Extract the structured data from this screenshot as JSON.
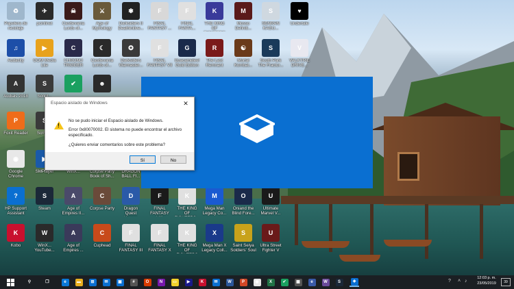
{
  "desktop": {
    "icons": [
      {
        "label": "Papelera de reciclaje",
        "color": "#9fb7cc",
        "glyph": "♻"
      },
      {
        "label": "pcinfinet",
        "color": "#2a2a2a",
        "glyph": "✈"
      },
      {
        "label": "Castlevania Lords of...",
        "color": "#3a1a1a",
        "glyph": "☠"
      },
      {
        "label": "Age of Mythology",
        "color": "#6a5a3a",
        "glyph": "⚔"
      },
      {
        "label": "Darksiders II Deathinitive...",
        "color": "#222",
        "glyph": "✾"
      },
      {
        "label": "FINAL FANTASY ...",
        "color": "#d8d8d8",
        "glyph": "F"
      },
      {
        "label": "FINAL FANTA...",
        "color": "#e0e0e0",
        "glyph": "F"
      },
      {
        "label": "THE KING OF FIGHTERS X...",
        "color": "#3a3a9a",
        "glyph": "K"
      },
      {
        "label": "Mosso Definiti...",
        "color": "#5a1a1a",
        "glyph": "M"
      },
      {
        "label": "SENRAN KAGU...",
        "color": "#cfd8e0",
        "glyph": "S"
      },
      {
        "label": "Undertale",
        "color": "#000",
        "glyph": "♥"
      },
      {
        "label": "Audacity",
        "color": "#1d4fa8",
        "glyph": "♫"
      },
      {
        "label": "GOM Media Lite",
        "color": "#e8a21c",
        "glyph": "▶"
      },
      {
        "label": "CHRONO TRIGGER",
        "color": "#2a2a4a",
        "glyph": "C"
      },
      {
        "label": "Castlevania Lords of...",
        "color": "#2a2a2a",
        "glyph": "☾"
      },
      {
        "label": "Darksiders Warmaster...",
        "color": "#3a3a3a",
        "glyph": "✪"
      },
      {
        "label": "FINAL FANTASY VII",
        "color": "#e0e0e0",
        "glyph": "F"
      },
      {
        "label": "Guacamelee! Gold Edition",
        "color": "#1a2a4a",
        "glyph": "G"
      },
      {
        "label": "The Last Remnant",
        "color": "#7a1a1a",
        "glyph": "R"
      },
      {
        "label": "Mortal Kombat...",
        "color": "#6a3a1a",
        "glyph": "☯"
      },
      {
        "label": "South Park The Fractur...",
        "color": "#1a3a5a",
        "glyph": "S"
      },
      {
        "label": "VALKYRIE DRIVE...",
        "color": "#e8e8f0",
        "glyph": "V"
      },
      {
        "label": "Audials 2018",
        "color": "#333",
        "glyph": "A"
      },
      {
        "label": "Script...",
        "color": "#3a3a3a",
        "glyph": "S"
      },
      {
        "label": "",
        "color": "#1aa060",
        "glyph": "✔"
      },
      {
        "label": "",
        "color": "#2a2a2a",
        "glyph": "☻"
      },
      {
        "label": "Foxit Reader",
        "color": "#ef6c1a",
        "glyph": "P"
      },
      {
        "label": "Scrive...",
        "color": "#3a3a3a",
        "glyph": "S"
      },
      {
        "label": "Google Chrome",
        "color": "#e8e8e8",
        "glyph": "◉"
      },
      {
        "label": "SMPlayer",
        "color": "#1a5aa8",
        "glyph": "▶"
      },
      {
        "label": "WinX...",
        "color": "#555",
        "glyph": "W"
      },
      {
        "label": "Corpse Party Book of Sh...",
        "color": "#3a1a1a",
        "glyph": "C"
      },
      {
        "label": "DRAGON BALL FI...",
        "color": "#e8a21c",
        "glyph": "D"
      },
      {
        "label": "HP Support Assistant",
        "color": "#0a6fd1",
        "glyph": "?"
      },
      {
        "label": "Steam",
        "color": "#1b2838",
        "glyph": "S"
      },
      {
        "label": "Age of Empires II...",
        "color": "#4a4a6a",
        "glyph": "A"
      },
      {
        "label": "Corpse Party",
        "color": "#6a4a3a",
        "glyph": "C"
      },
      {
        "label": "Dragon Quest Heroes",
        "color": "#2a5aa8",
        "glyph": "D"
      },
      {
        "label": "FINAL FANTASY VIII",
        "color": "#1a1a1a",
        "glyph": "F"
      },
      {
        "label": "THE KING OF FIGHTERS...",
        "color": "#e0e0e0",
        "glyph": "K"
      },
      {
        "label": "Mega Man Legacy Co...",
        "color": "#1a5ad1",
        "glyph": "M"
      },
      {
        "label": "Oniand the Blind Fore...",
        "color": "#1a2a4a",
        "glyph": "O"
      },
      {
        "label": "Ultimate Marvel V...",
        "color": "#1a1a1a",
        "glyph": "U"
      },
      {
        "label": "Kobo",
        "color": "#c8102e",
        "glyph": "K"
      },
      {
        "label": "WinX... YouTube...",
        "color": "#2a2a2a",
        "glyph": "W"
      },
      {
        "label": "Age of Empires ...",
        "color": "#3a3a5a",
        "glyph": "A"
      },
      {
        "label": "Cuphead",
        "color": "#c84a1a",
        "glyph": "C"
      },
      {
        "label": "FINAL FANTASY III",
        "color": "#e0e0e0",
        "glyph": "F"
      },
      {
        "label": "FINAL FANTASY X",
        "color": "#e0e0e0",
        "glyph": "F"
      },
      {
        "label": "THE KING OF FIGHTERS X...",
        "color": "#e0e0e0",
        "glyph": "K"
      },
      {
        "label": "Mega Man X Legacy Coll...",
        "color": "#1a3a8a",
        "glyph": "X"
      },
      {
        "label": "Saint Seiya Soldiers' Soul",
        "color": "#c8a21a",
        "glyph": "S"
      },
      {
        "label": "Ultra Street Fighter V",
        "color": "#6a1a1a",
        "glyph": "U"
      }
    ]
  },
  "dialog": {
    "title": "Espacio aislado de Windows",
    "close": "✕",
    "line1": "No se pudo iniciar el Espacio aislado de Windows.",
    "line2": "Error 0x80070002. El sistema no puede encontrar el archivo especificado.",
    "line3": "¿Quieres enviar comentarios sobre este problema?",
    "yes": "Sí",
    "no": "No"
  },
  "taskbar": {
    "start_icon": "windows-logo",
    "items": [
      {
        "name": "search",
        "color": "transparent",
        "glyph": "⚲"
      },
      {
        "name": "task-view",
        "color": "transparent",
        "glyph": "❐"
      },
      {
        "name": "edge",
        "color": "#0a78d7",
        "glyph": "e"
      },
      {
        "name": "file-explorer",
        "color": "#e8b020",
        "glyph": "▬"
      },
      {
        "name": "store",
        "color": "#0a6fd1",
        "glyph": "⊞"
      },
      {
        "name": "mail",
        "color": "#0a6fd1",
        "glyph": "✉"
      },
      {
        "name": "photos",
        "color": "#0a6fd1",
        "glyph": "▣"
      },
      {
        "name": "calculator",
        "color": "#555",
        "glyph": "#"
      },
      {
        "name": "office",
        "color": "#d83b01",
        "glyph": "O"
      },
      {
        "name": "onenote",
        "color": "#7719aa",
        "glyph": "N"
      },
      {
        "name": "sticky-notes",
        "color": "#f2d22a",
        "glyph": "▭"
      },
      {
        "name": "media",
        "color": "#1a1a8a",
        "glyph": "▶"
      },
      {
        "name": "kobo",
        "color": "#c8102e",
        "glyph": "K"
      },
      {
        "name": "mail-2",
        "color": "#0a6fd1",
        "glyph": "✉"
      },
      {
        "name": "word",
        "color": "#2b579a",
        "glyph": "W"
      },
      {
        "name": "powerpoint",
        "color": "#d24726",
        "glyph": "P"
      },
      {
        "name": "chrome",
        "color": "#e8e8e8",
        "glyph": "◉"
      },
      {
        "name": "excel",
        "color": "#217346",
        "glyph": "X"
      },
      {
        "name": "greenshot",
        "color": "#1aa060",
        "glyph": "✔"
      },
      {
        "name": "gallery",
        "color": "#555",
        "glyph": "▦"
      },
      {
        "name": "ie",
        "color": "#3a5aa8",
        "glyph": "e"
      },
      {
        "name": "winrar",
        "color": "#6a4a9a",
        "glyph": "W"
      },
      {
        "name": "steam",
        "color": "#1b2838",
        "glyph": "S"
      },
      {
        "name": "sandbox",
        "color": "#0a6fd1",
        "glyph": "◈"
      }
    ],
    "help_glyph": "?",
    "time": "12:03 p. m.",
    "date": "23/05/2019",
    "notifications": "39"
  },
  "colors": {
    "sandbox_blue": "#0a6fd1",
    "taskbar": "#1b1f23",
    "dialog_bg": "#f0f0f0"
  }
}
